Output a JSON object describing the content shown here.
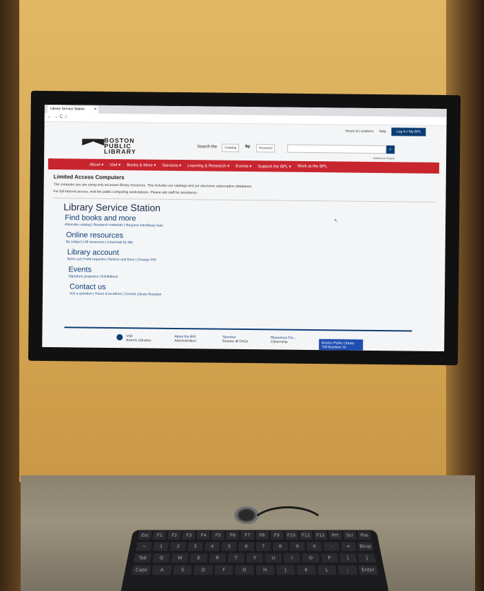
{
  "browser": {
    "tab_title": "Library Service Station",
    "tab_close": "×",
    "nav_controls": "← → C ⌂"
  },
  "utility": {
    "hours": "Hours & Locations",
    "help": "Help",
    "login": "Log In / My BPL"
  },
  "logo": {
    "line1": "BOSTON",
    "line2": "PUBLIC",
    "line3": "LIBRARY"
  },
  "search": {
    "label": "Search the",
    "scope": "Catalog",
    "by_label": "by",
    "type": "Keyword",
    "button_icon": "search-icon",
    "button_glyph": "⌕",
    "advanced": "Advanced Search"
  },
  "nav": {
    "items": [
      "About ▾",
      "Visit ▾",
      "Books & More ▾",
      "Services ▾",
      "Learning & Research ▾",
      "Events ▾",
      "Support the BPL ▾",
      "Work at the BPL"
    ]
  },
  "notice": {
    "title": "Limited Access Computers",
    "text1": "The computer you are using only accesses library resources. This includes our catalogs and our electronic subscription databases.",
    "text2": "For full internet access, visit the public computing workstations. Please ask staff for assistance."
  },
  "main": {
    "page_title": "Library Service Station",
    "sections": [
      {
        "title": "Find books and more",
        "links": "Alternate catalog | Research materials | Request interlibrary loan"
      },
      {
        "title": "Online resources",
        "links": "By subject | All resources | eJournals by title"
      },
      {
        "title": "Library account",
        "links": "Items out | Hold requests | Notices and fines | Change PIN"
      },
      {
        "title": "Events",
        "links": "Signature programs | Exhibitions"
      },
      {
        "title": "Contact us",
        "links": "Ask a question | Hours & locations | Central Library floorplan"
      }
    ]
  },
  "footer": {
    "visit": "Visit",
    "visit_sub": "Branch Libraries",
    "about": "About the BPL",
    "about_sub": "Administration",
    "services": "Services",
    "services_sub": "Browse all FAQs",
    "resources": "Resources For...",
    "resources_sub": "Citizenship",
    "bpl_box": "Boston Public Library",
    "bpl_box_sub": "700 Boylston St"
  },
  "keyboard": {
    "row1": [
      "Esc",
      "F1",
      "F2",
      "F3",
      "F4",
      "F5",
      "F6",
      "F7",
      "F8",
      "F9",
      "F10",
      "F11",
      "F12",
      "Prt",
      "Scr",
      "Pse"
    ],
    "row2": [
      "~",
      "1",
      "2",
      "3",
      "4",
      "5",
      "6",
      "7",
      "8",
      "9",
      "0",
      "-",
      "=",
      "Bksp"
    ],
    "row3": [
      "Tab",
      "Q",
      "W",
      "E",
      "R",
      "T",
      "Y",
      "U",
      "I",
      "O",
      "P",
      "[",
      "]"
    ],
    "row4": [
      "Caps",
      "A",
      "S",
      "D",
      "F",
      "G",
      "H",
      "J",
      "K",
      "L",
      ";",
      "Enter"
    ]
  }
}
